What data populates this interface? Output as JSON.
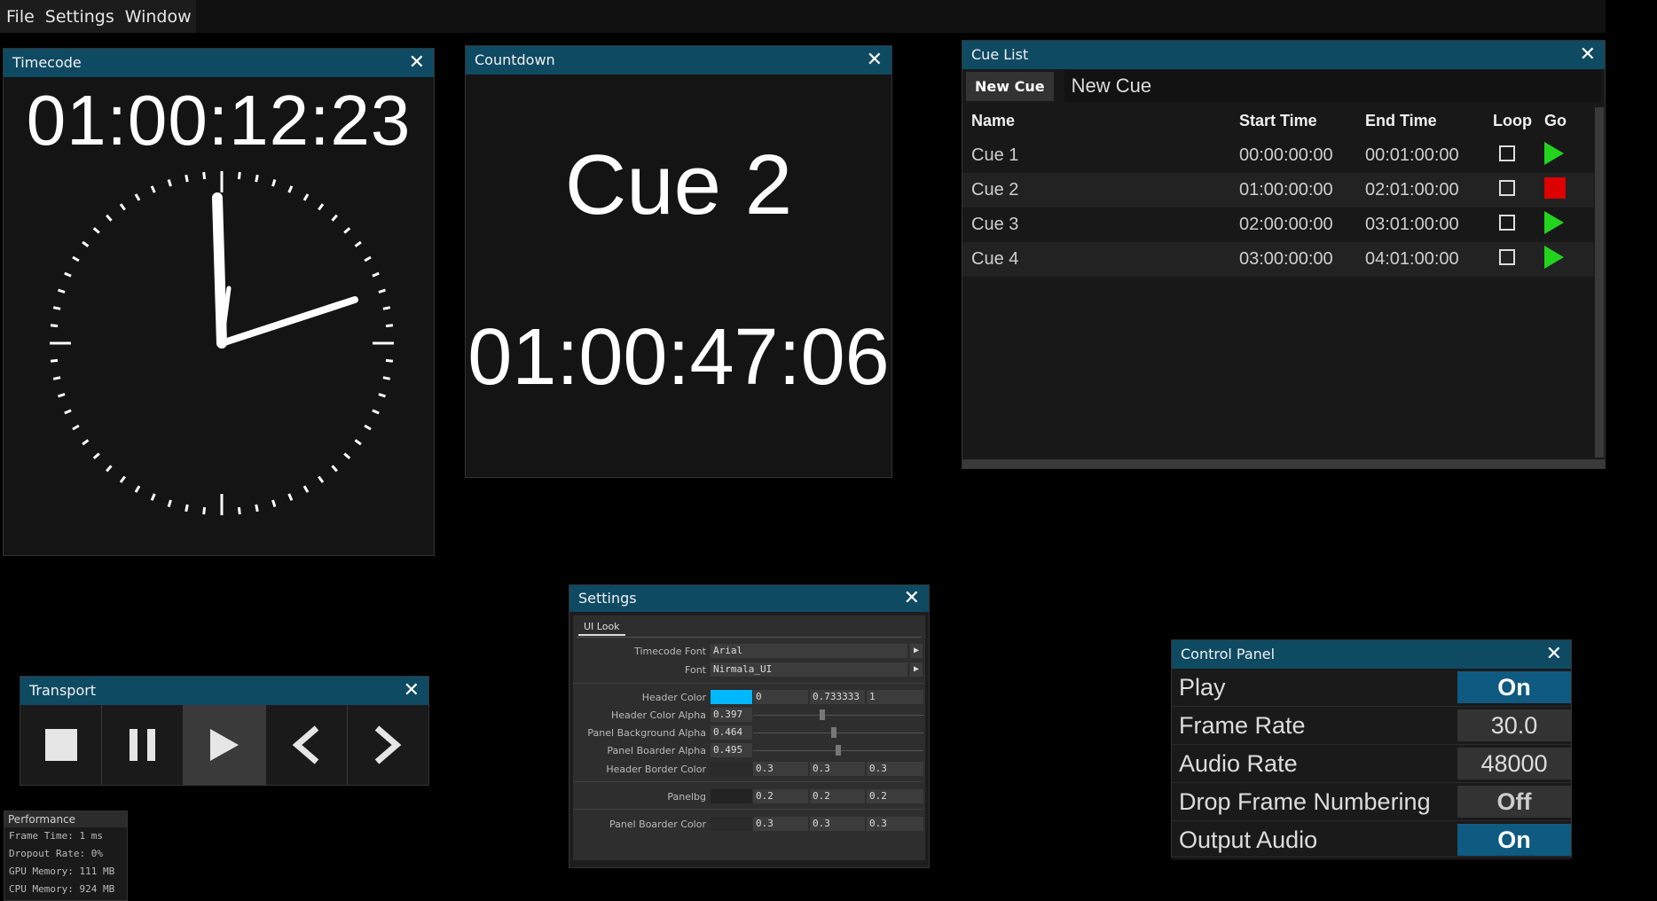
{
  "menu": {
    "items": [
      "File",
      "Settings",
      "Window"
    ]
  },
  "timecode": {
    "title": "Timecode",
    "close": "✕",
    "value": "01:00:12:23"
  },
  "countdown": {
    "title": "Countdown",
    "close": "✕",
    "cue": "Cue 2",
    "value": "01:00:47:06"
  },
  "cue_list": {
    "title": "Cue List",
    "close": "✕",
    "new_cue_button": "New Cue",
    "new_cue_input": "New Cue",
    "columns": [
      "Name",
      "Start Time",
      "End Time",
      "Loop",
      "Go"
    ],
    "rows": [
      {
        "name": "Cue 1",
        "start": "00:00:00:00",
        "end": "00:01:00:00",
        "loop": false,
        "go": "play"
      },
      {
        "name": "Cue 2",
        "start": "01:00:00:00",
        "end": "02:01:00:00",
        "loop": false,
        "go": "stop"
      },
      {
        "name": "Cue 3",
        "start": "02:00:00:00",
        "end": "03:01:00:00",
        "loop": false,
        "go": "play"
      },
      {
        "name": "Cue 4",
        "start": "03:00:00:00",
        "end": "04:01:00:00",
        "loop": false,
        "go": "play"
      }
    ]
  },
  "settings": {
    "title": "Settings",
    "close": "✕",
    "tab": "UI Look",
    "timecode_font_label": "Timecode Font",
    "timecode_font": "Arial",
    "font_label": "Font",
    "font": "Nirmala_UI",
    "header_color_label": "Header Color",
    "header_color": [
      "0",
      "0.733333",
      "1"
    ],
    "header_color_swatch": "#00b8ff",
    "header_color_alpha_label": "Header Color Alpha",
    "header_color_alpha": "0.397",
    "panel_bg_alpha_label": "Panel Background Alpha",
    "panel_bg_alpha": "0.464",
    "panel_border_alpha_label": "Panel Boarder Alpha",
    "panel_border_alpha": "0.495",
    "header_border_color_label": "Header Border Color",
    "header_border_color": [
      "0.3",
      "0.3",
      "0.3"
    ],
    "panelbg_label": "Panelbg",
    "panelbg": [
      "0.2",
      "0.2",
      "0.2"
    ],
    "panel_border_color_label": "Panel Boarder Color",
    "panel_border_color": [
      "0.3",
      "0.3",
      "0.3"
    ]
  },
  "transport": {
    "title": "Transport",
    "close": "✕"
  },
  "performance": {
    "title": "Performance",
    "frame_time": "Frame Time: 1 ms",
    "dropout_rate": "Dropout Rate: 0%",
    "gpu_memory": "GPU Memory: 111 MB",
    "cpu_memory": "CPU Memory: 924 MB"
  },
  "control_panel": {
    "title": "Control Panel",
    "close": "✕",
    "rows": [
      {
        "label": "Play",
        "value": "On",
        "state": "on"
      },
      {
        "label": "Frame Rate",
        "value": "30.0",
        "state": "value"
      },
      {
        "label": "Audio Rate",
        "value": "48000",
        "state": "value"
      },
      {
        "label": "Drop Frame Numbering",
        "value": "Off",
        "state": "off"
      },
      {
        "label": "Output Audio",
        "value": "On",
        "state": "on"
      }
    ]
  },
  "colors": {
    "header": "#0f4a63",
    "play_green": "#22d41e",
    "stop_red": "#dd0000"
  }
}
